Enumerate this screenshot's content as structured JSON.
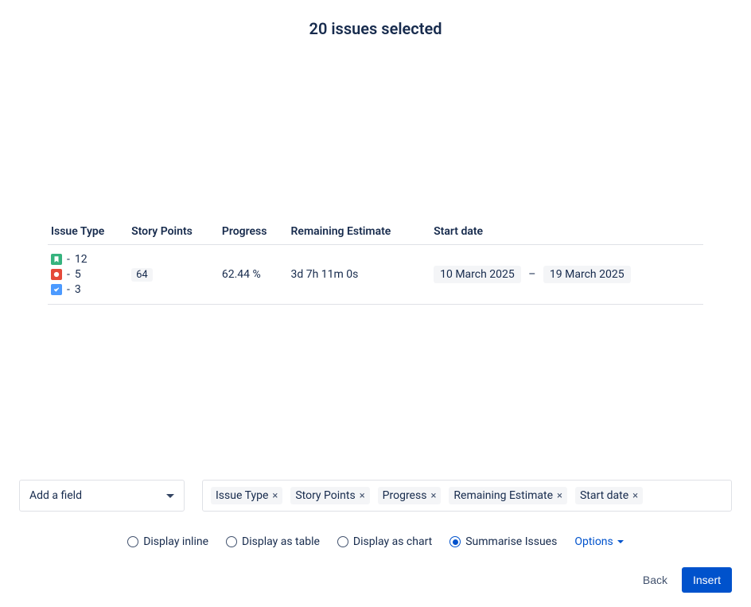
{
  "title": "20 issues selected",
  "table": {
    "headers": {
      "issue_type": "Issue Type",
      "story_points": "Story Points",
      "progress": "Progress",
      "remaining_estimate": "Remaining Estimate",
      "start_date": "Start date"
    },
    "row": {
      "issue_types": [
        {
          "icon": "story",
          "count": "12"
        },
        {
          "icon": "bug",
          "count": "5"
        },
        {
          "icon": "task",
          "count": "3"
        }
      ],
      "story_points": "64",
      "progress": "62.44 %",
      "remaining_estimate": "3d 7h 11m 0s",
      "start_date_from": "10 March 2025",
      "start_date_sep": "–",
      "start_date_to": "19 March 2025"
    }
  },
  "add_field": {
    "placeholder": "Add a field"
  },
  "chips": [
    "Issue Type",
    "Story Points",
    "Progress",
    "Remaining Estimate",
    "Start date"
  ],
  "display_options": {
    "inline": "Display inline",
    "table": "Display as table",
    "chart": "Display as chart",
    "summarise": "Summarise Issues",
    "selected": "summarise",
    "options_label": "Options"
  },
  "buttons": {
    "back": "Back",
    "insert": "Insert"
  }
}
